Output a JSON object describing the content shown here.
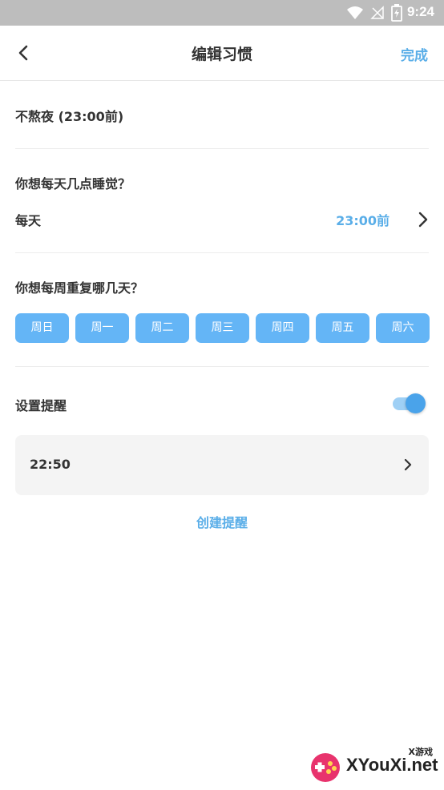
{
  "status_bar": {
    "time": "9:24",
    "icons": [
      "wifi-icon",
      "signal-off-icon",
      "battery-charging-icon"
    ]
  },
  "header": {
    "title": "编辑习惯",
    "back_icon": "chevron-left-icon",
    "done_label": "完成"
  },
  "habit": {
    "name": "不熬夜 (23:00前)"
  },
  "sleep_time": {
    "question": "你想每天几点睡觉？",
    "frequency_label": "每天",
    "value": "23:00前"
  },
  "repeat_days": {
    "question": "你想每周重复哪几天？",
    "days": [
      {
        "label": "周日",
        "selected": true
      },
      {
        "label": "周一",
        "selected": true
      },
      {
        "label": "周二",
        "selected": true
      },
      {
        "label": "周三",
        "selected": true
      },
      {
        "label": "周四",
        "selected": true
      },
      {
        "label": "周五",
        "selected": true
      },
      {
        "label": "周六",
        "selected": true
      }
    ]
  },
  "reminder": {
    "label": "设置提醒",
    "enabled": true,
    "items": [
      {
        "time": "22:50"
      }
    ],
    "create_label": "创建提醒"
  },
  "watermark": {
    "text": "XYouXi.net",
    "subtext": "X游戏"
  },
  "colors": {
    "accent": "#5aaee8",
    "day_chip": "#64b5f6",
    "status_bar": "#bdbdbd",
    "card_bg": "#f4f4f4"
  }
}
